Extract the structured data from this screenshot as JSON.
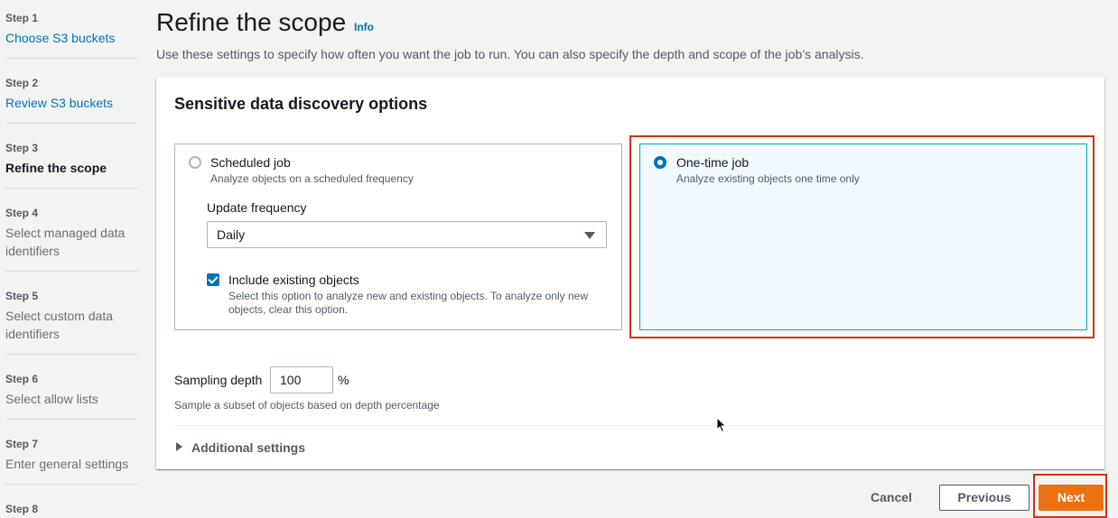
{
  "sidebar": {
    "steps": [
      {
        "number": "Step 1",
        "title": "Choose S3 buckets"
      },
      {
        "number": "Step 2",
        "title": "Review S3 buckets"
      },
      {
        "number": "Step 3",
        "title": "Refine the scope"
      },
      {
        "number": "Step 4",
        "title": "Select managed data",
        "title2": "identifiers"
      },
      {
        "number": "Step 5",
        "title": "Select custom data",
        "title2": "identifiers"
      },
      {
        "number": "Step 6",
        "title": "Select allow lists"
      },
      {
        "number": "Step 7",
        "title": "Enter general settings"
      },
      {
        "number": "Step 8",
        "title": ""
      }
    ]
  },
  "header": {
    "title": "Refine the scope",
    "info": "Info",
    "description": "Use these settings to specify how often you want the job to run. You can also specify the depth and scope of the job’s analysis."
  },
  "panel": {
    "title": "Sensitive data discovery options",
    "scheduled": {
      "label": "Scheduled job",
      "description": "Analyze objects on a scheduled frequency",
      "frequency_label": "Update frequency",
      "frequency_value": "Daily",
      "include_label": "Include existing objects",
      "include_desc_1": "Select this option to analyze new and existing objects. To analyze only new",
      "include_desc_2": "objects, clear this option."
    },
    "onetime": {
      "label": "One-time job",
      "description": "Analyze existing objects one time only"
    },
    "sampling": {
      "label": "Sampling depth",
      "value": "100",
      "unit": "%",
      "description": "Sample a subset of objects based on depth percentage"
    },
    "additional": "Additional settings"
  },
  "footer": {
    "cancel": "Cancel",
    "previous": "Previous",
    "next": "Next"
  },
  "colors": {
    "accent": "#0073bb",
    "primary_button": "#ec7211",
    "highlight": "#d13212"
  }
}
